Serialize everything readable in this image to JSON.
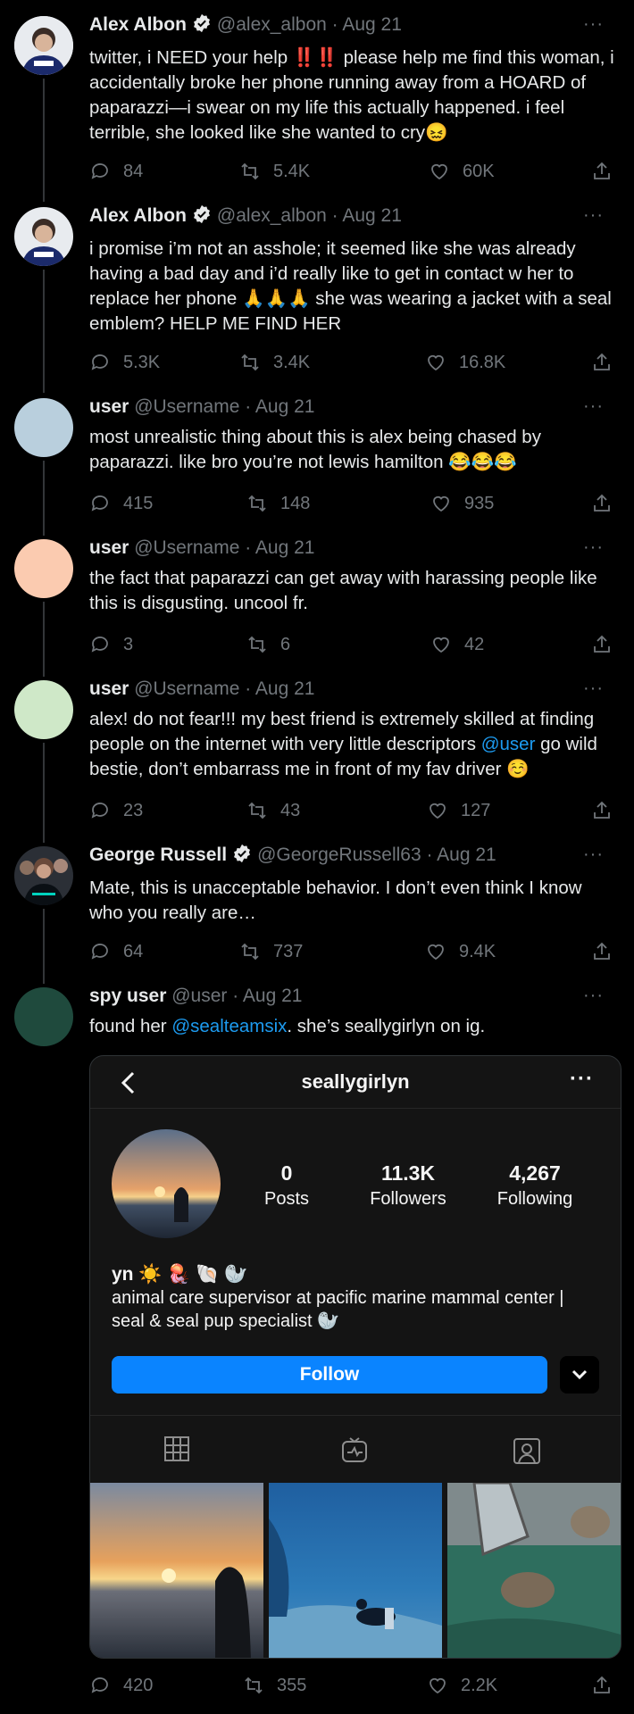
{
  "tweets": [
    {
      "name": "Alex Albon",
      "verified": true,
      "handle": "@alex_albon",
      "date": "· Aug 21",
      "text": "twitter, i NEED your help ‼️‼️ please help me find this woman, i accidentally broke her phone running away from a HOARD of paparazzi—i swear on my life this actually happened. i feel terrible, she looked like she wanted to cry😖",
      "replies": "84",
      "retweets": "5.4K",
      "likes": "60K"
    },
    {
      "name": "Alex Albon",
      "verified": true,
      "handle": "@alex_albon",
      "date": "· Aug 21",
      "text": "i promise i’m not an asshole; it seemed like she was already having a bad day and i’d really like to get in contact w her to replace her phone 🙏🙏🙏 she was wearing a jacket with a seal emblem? HELP ME FIND HER",
      "replies": "5.3K",
      "retweets": "3.4K",
      "likes": "16.8K"
    },
    {
      "name": "user",
      "verified": false,
      "handle": "@Username",
      "date": "· Aug 21",
      "text": "most unrealistic thing about this is alex being chased by paparazzi. like bro you’re not lewis hamilton 😂😂😂",
      "replies": "415",
      "retweets": "148",
      "likes": "935",
      "avatar_color": "#b9cfdd"
    },
    {
      "name": "user",
      "verified": false,
      "handle": "@Username",
      "date": "· Aug 21",
      "text": "the fact that paparazzi can get away with harassing people like this is disgusting. uncool fr.",
      "replies": "3",
      "retweets": "6",
      "likes": "42",
      "avatar_color": "#fbcbb0"
    },
    {
      "name": "user",
      "verified": false,
      "handle": "@Username",
      "date": "· Aug 21",
      "text_before": "alex! do not fear!!! my best friend is extremely skilled at finding people on the internet with very little descriptors ",
      "mention": "@user",
      "text_after": " go wild bestie, don’t embarrass me in front of my fav driver ☺️",
      "replies": "23",
      "retweets": "43",
      "likes": "127",
      "avatar_color": "#cfe8c8"
    },
    {
      "name": "George Russell",
      "verified": true,
      "handle": "@GeorgeRussell63",
      "date": "· Aug 21",
      "text": "Mate, this is unacceptable behavior. I don’t even think I know who you really are…",
      "replies": "64",
      "retweets": "737",
      "likes": "9.4K"
    },
    {
      "name": "spy user",
      "verified": false,
      "handle": "@user",
      "date": "· Aug 21",
      "text_before": "found her ",
      "mention": "@sealteamsix",
      "text_after": ". she’s seallygirlyn on ig.",
      "replies": "420",
      "retweets": "355",
      "likes": "2.2K",
      "avatar_color": "#1f4a3d"
    }
  ],
  "instagram": {
    "username": "seallygirlyn",
    "posts_count": "0",
    "posts_label": "Posts",
    "followers_count": "11.3K",
    "followers_label": "Followers",
    "following_count": "4,267",
    "following_label": "Following",
    "display_name": "yn ☀️ 🪼 🐚 🦭",
    "bio": "animal care supervisor at pacific marine mammal center | seal & seal pup specialist 🦭",
    "follow_label": "Follow"
  },
  "more_label": "···",
  "colors": {
    "background": "#000000",
    "text": "#e7e9ea",
    "muted": "#71767b",
    "link": "#1d9bf0",
    "ig_follow": "#0a84ff"
  }
}
